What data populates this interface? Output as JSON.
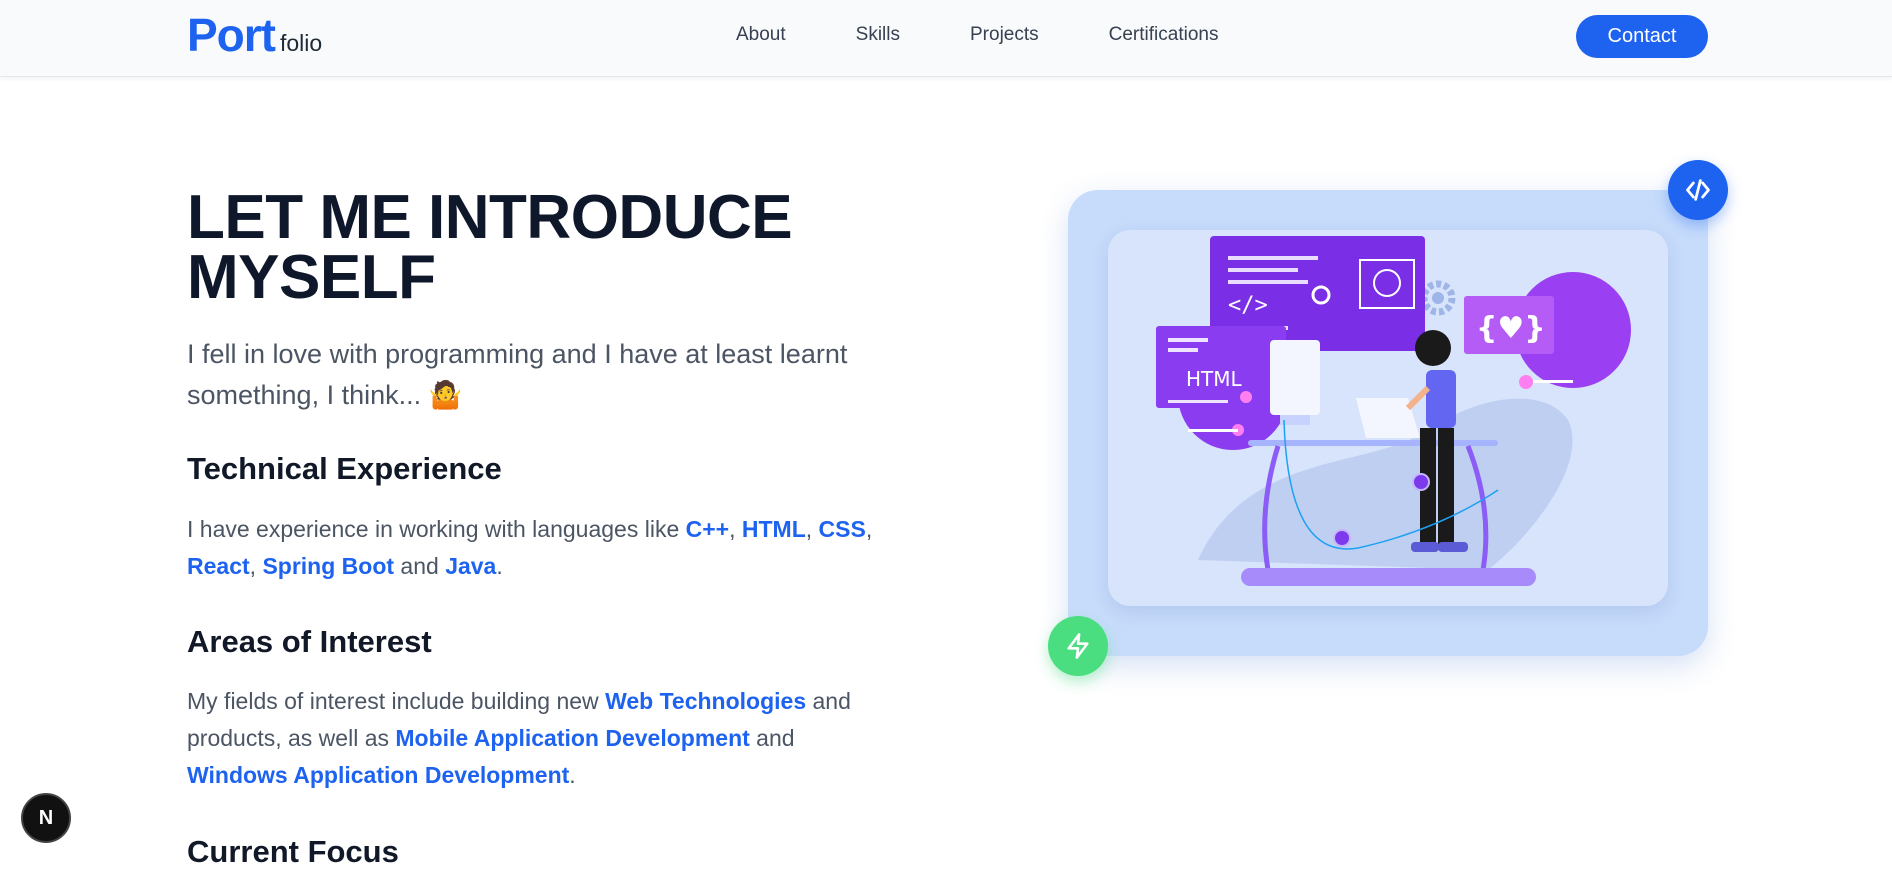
{
  "header": {
    "logo_main": "Port",
    "logo_sub": "folio",
    "nav": [
      "About",
      "Skills",
      "Projects",
      "Certifications"
    ],
    "contact_label": "Contact"
  },
  "hero": {
    "title_line1": "LET ME INTRODUCE",
    "title_line2": "MYSELF",
    "intro_line1": "I fell in love with programming and I have at least learnt",
    "intro_line2": "something, I think... 🤷"
  },
  "technical": {
    "heading": "Technical Experience",
    "text_pre": "I have experience in working with languages like ",
    "langs": [
      "C++",
      "HTML",
      "CSS",
      "React",
      "Spring Boot",
      "Java"
    ],
    "sep": ", ",
    "and": " and ",
    "end": "."
  },
  "interests": {
    "heading": "Areas of Interest",
    "text_pre": "My fields of interest include building new ",
    "hl1": "Web Technologies",
    "mid1": " and products, as well as ",
    "hl2": "Mobile Application Development",
    "mid2": " and ",
    "hl3": "Windows Application Development",
    "end": "."
  },
  "focus": {
    "heading": "Current Focus"
  },
  "illustration": {
    "html_label": "HTML",
    "braces_label": "{♥}",
    "code_label": "</>"
  },
  "badge": {
    "letter": "N"
  },
  "colors": {
    "accent": "#1d63f0",
    "purple": "#7c3aed",
    "green": "#4ade80"
  }
}
